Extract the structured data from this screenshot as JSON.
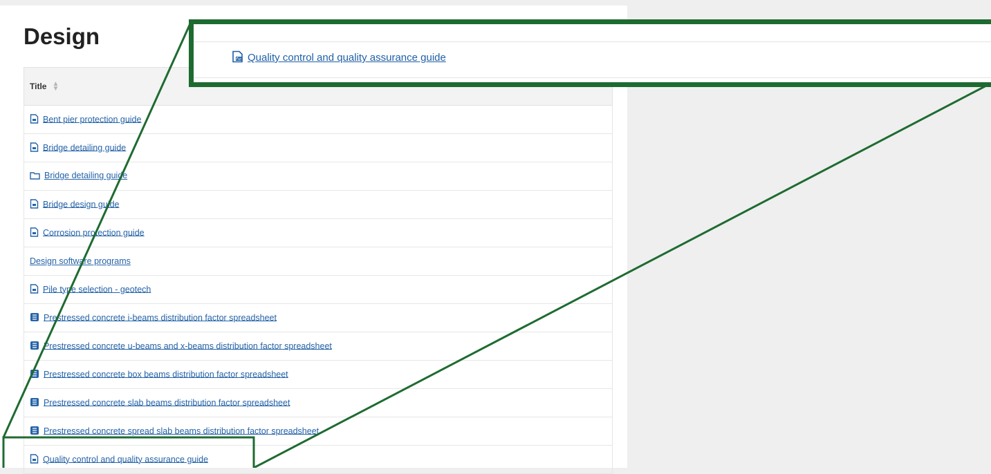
{
  "page": {
    "heading": "Design",
    "table": {
      "column_header": "Title",
      "rows": [
        {
          "label": "Bent pier protection guide",
          "icon": "document-icon"
        },
        {
          "label": "Bridge detailing guide",
          "icon": "document-icon"
        },
        {
          "label": "Bridge detailing guide",
          "icon": "folder-icon"
        },
        {
          "label": "Bridge design guide",
          "icon": "document-icon"
        },
        {
          "label": "Corrosion protection guide",
          "icon": "document-icon"
        },
        {
          "label": "Design software programs",
          "icon": ""
        },
        {
          "label": "Pile type selection - geotech",
          "icon": "document-icon"
        },
        {
          "label": "Prestressed concrete i-beams distribution factor spreadsheet",
          "icon": "spreadsheet-icon"
        },
        {
          "label": "Prestressed concrete u-beams and x-beams distribution factor spreadsheet",
          "icon": "spreadsheet-icon"
        },
        {
          "label": "Prestressed concrete box beams distribution factor spreadsheet",
          "icon": "spreadsheet-icon"
        },
        {
          "label": "Prestressed concrete slab beams distribution factor spreadsheet",
          "icon": "spreadsheet-icon"
        },
        {
          "label": "Prestressed concrete spread slab beams distribution factor spreadsheet",
          "icon": "spreadsheet-icon"
        },
        {
          "label": "Quality control and quality assurance guide",
          "icon": "document-icon"
        }
      ]
    }
  },
  "zoom": {
    "label": "Quality control and quality assurance guide",
    "icon": "pdf-document-icon"
  },
  "colors": {
    "link": "#2563a8",
    "callout": "#1e6b31",
    "background": "#efefef"
  }
}
